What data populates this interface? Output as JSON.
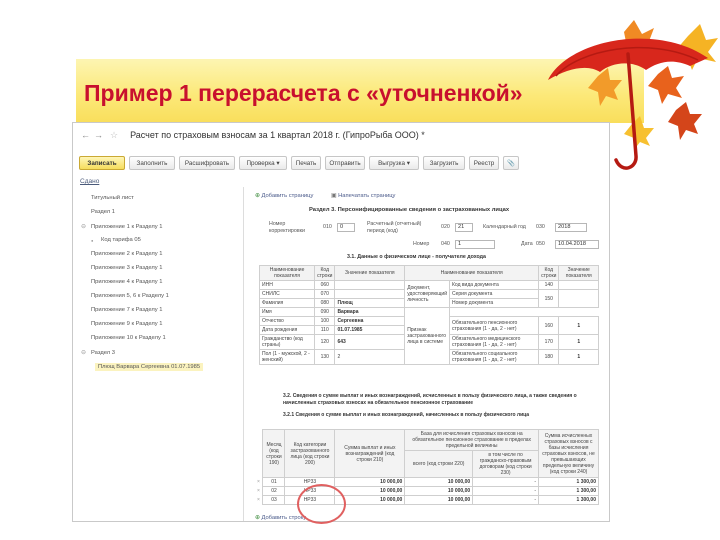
{
  "slide": {
    "title": "Пример 1 перерасчета с «уточненкой»"
  },
  "window": {
    "back_icon": "←",
    "forward_icon": "→",
    "star_icon": "☆",
    "title": "Расчет по страховым взносам за 1 квартал 2018 г. (ГипроРыба ООО) *"
  },
  "toolbar": {
    "buttons": [
      "Записать",
      "Заполнить",
      "Расшифровать",
      "Проверка ▾",
      "Печать",
      "Отправить",
      "Выгрузка ▾",
      "Загрузить",
      "Реестр"
    ],
    "attach_icon": "📎"
  },
  "save_link": "Сдано",
  "sidebar": {
    "items": [
      {
        "label": "Титульный лист",
        "toggle": ""
      },
      {
        "label": "Раздел 1",
        "toggle": ""
      },
      {
        "label": "Приложение 1 к Разделу 1",
        "toggle": "⊖"
      },
      {
        "label": "Код тарифа 05",
        "toggle": "●"
      },
      {
        "label": "Приложение 2 к Разделу 1",
        "toggle": ""
      },
      {
        "label": "Приложение 3 к Разделу 1",
        "toggle": ""
      },
      {
        "label": "Приложение 4 к Разделу 1",
        "toggle": ""
      },
      {
        "label": "Приложения 5, 6 к Разделу 1",
        "toggle": ""
      },
      {
        "label": "Приложение 7 к Разделу 1",
        "toggle": ""
      },
      {
        "label": "Приложение 9 к Разделу 1",
        "toggle": ""
      },
      {
        "label": "Приложение 10 к Разделу 1",
        "toggle": ""
      },
      {
        "label": "Раздел 3",
        "toggle": "⊖"
      },
      {
        "label": "Плющ Варвара Сергеевна 01.07.1985",
        "toggle": ""
      }
    ]
  },
  "content": {
    "add_page": "Добавить страницу",
    "print_page": "Напечатать страницу",
    "section_title": "Раздел 3. Персонифицированные сведения о застрахованных лицах",
    "fields": {
      "corr_label": "Номер корректировки",
      "corr_code": "010",
      "corr_value": "0",
      "period_label": "Расчетный (отчетный) период (код)",
      "period_code": "020",
      "period_value": "21",
      "year_label": "Календарный год",
      "year_code": "030",
      "year_value": "2018",
      "num_label": "Номер",
      "num_code": "040",
      "num_value": "1",
      "date_label": "Дата",
      "date_code": "050",
      "date_value": "10.04.2018"
    },
    "sub31": "3.1. Данные о физическом лице - получателе дохода",
    "t1_headers": [
      "Наименование показателя",
      "Код строки",
      "Значение показателя",
      "Наименование показателя",
      "Код строки",
      "Значение показателя"
    ],
    "t1_rows": [
      {
        "n": "ИНН",
        "c": "060",
        "v": ""
      },
      {
        "n": "СНИЛС",
        "c": "070",
        "v": ""
      },
      {
        "n": "Фамилия",
        "c": "080",
        "v": "Плющ"
      },
      {
        "n": "Имя",
        "c": "090",
        "v": "Варвара"
      },
      {
        "n": "Отчество",
        "c": "100",
        "v": "Сергеевна"
      },
      {
        "n": "Дата рождения",
        "c": "110",
        "v": "01.07.1985"
      },
      {
        "n": "Гражданство (код страны)",
        "c": "120",
        "v": "643"
      },
      {
        "n": "Пол (1 - мужской, 2 - женский)",
        "c": "130",
        "v": "2"
      }
    ],
    "t1_right_group1": "Документ, удостоверяющий личность",
    "t1_right_group2": "Признак застрахованного лица в системе",
    "t1_right_rows": [
      {
        "n": "Код вида документа",
        "c": "140",
        "v": ""
      },
      {
        "n": "Серия документа",
        "c": "150",
        "v": ""
      },
      {
        "n": "Номер документа",
        "c": "",
        "v": ""
      },
      {
        "n": "Обязательного пенсионного страхования (1 - да, 2 - нет)",
        "c": "160",
        "v": "1"
      },
      {
        "n": "Обязательного медицинского страхования (1 - да, 2 - нет)",
        "c": "170",
        "v": "1"
      },
      {
        "n": "Обязательного социального страхования (1 - да, 2 - нет)",
        "c": "180",
        "v": "1"
      }
    ],
    "sub32": "3.2. Сведения о сумме выплат и иных вознаграждений, исчисленных в пользу физического лица, а также сведения о начисленных страховых взносах на обязательное пенсионное страхование",
    "sub321": "3.2.1 Сведения о сумме выплат и иных вознаграждений, начисленных в пользу физического лица",
    "t2_headers": {
      "month": "Месяц (код строки 190)",
      "cat": "Код категории застрахованного лица (код строки 200)",
      "sum": "Сумма выплат и иных вознаграждений (код строки 210)",
      "base": "База для исчисления страховых взносов на обязательное пенсионное страхование в пределах предельной величины",
      "base_total": "всего (код строки 220)",
      "base_gpd": "в том числе по гражданско-правовым договорам (код строки 230)",
      "contrib": "Сумма исчисленных страховых взносов с базы исчисления страховых взносов, не превышающих предельную величину (код строки 240)"
    },
    "t2_rows": [
      {
        "m": "01",
        "cat": "НР33",
        "sum": "10 000,00",
        "base": "10 000,00",
        "gpd": "-",
        "contrib": "1 300,00"
      },
      {
        "m": "02",
        "cat": "НР33",
        "sum": "10 000,00",
        "base": "10 000,00",
        "gpd": "-",
        "contrib": "1 300,00"
      },
      {
        "m": "03",
        "cat": "НР33",
        "sum": "10 000,00",
        "base": "10 000,00",
        "gpd": "-",
        "contrib": "1 300,00"
      }
    ],
    "add_row": "Добавить строку"
  },
  "colors": {
    "title_red": "#c8102e",
    "band_yellow": "#fce97a",
    "selection": "#fbf3bf",
    "highlight_circle": "#e06060"
  }
}
